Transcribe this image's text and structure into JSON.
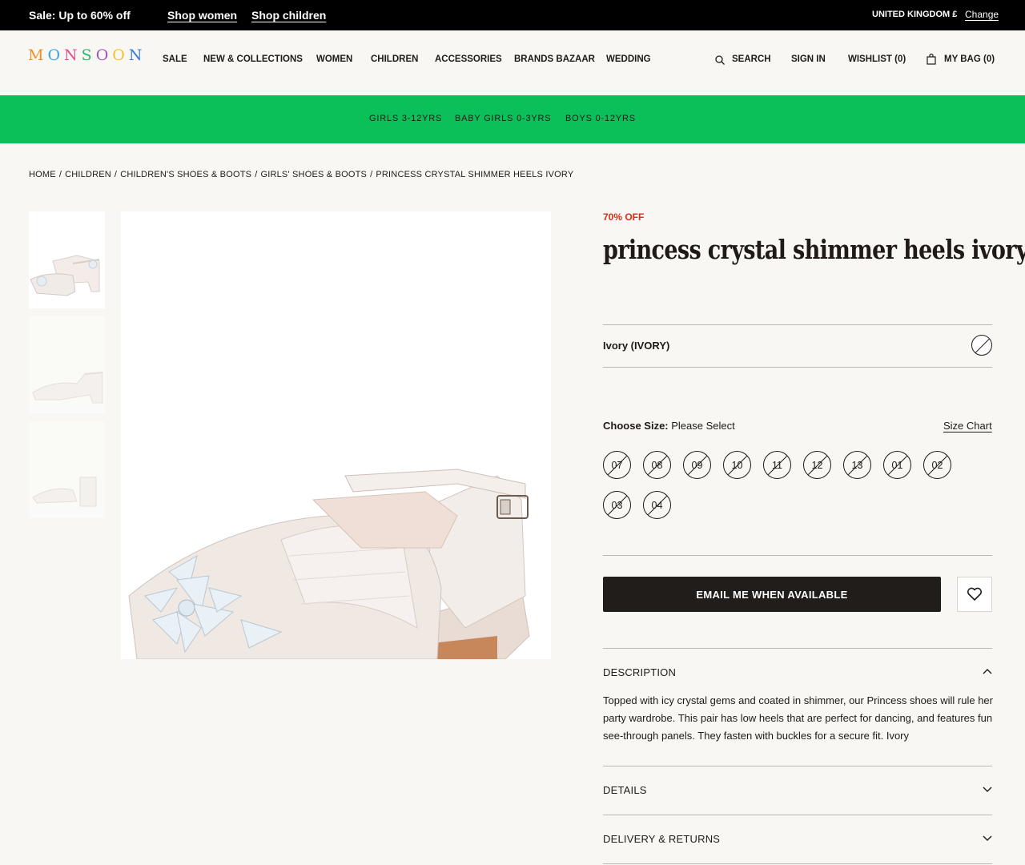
{
  "promo": {
    "sale_text": "Sale: Up to 60% off",
    "links": [
      "Shop women",
      "Shop children"
    ],
    "country": "UNITED KINGDOM £",
    "change": "Change"
  },
  "header": {
    "logo": "MONSOON",
    "logo_colors": [
      "#f28c28",
      "#3aa6dd",
      "#e54e8a",
      "#2bb673",
      "#9b59b6",
      "#f2c12e",
      "#3a7bd5"
    ],
    "nav": [
      "SALE",
      "NEW & COLLECTIONS",
      "WOMEN",
      "CHILDREN",
      "ACCESSORIES",
      "BRANDS BAZAAR",
      "WEDDING"
    ],
    "search": "SEARCH",
    "sign_in": "SIGN IN",
    "wishlist": "WISHLIST (0)",
    "bag": "MY BAG (0)"
  },
  "category_bar": {
    "color": "#0bbf59",
    "items": [
      "GIRLS 3-12YRS",
      "BABY GIRLS 0-3YRS",
      "BOYS 0-12YRS"
    ]
  },
  "breadcrumb": [
    "HOME",
    "CHILDREN",
    "CHILDREN'S SHOES & BOOTS",
    "GIRLS' SHOES & BOOTS",
    "PRINCESS CRYSTAL SHIMMER HEELS IVORY"
  ],
  "product": {
    "discount": "70% OFF",
    "title": "princess crystal shimmer heels ivory",
    "colour": "Ivory (IVORY)",
    "size_prompt": "Choose Size:",
    "size_value": "Please Select",
    "size_chart": "Size Chart",
    "sizes": [
      "07",
      "08",
      "09",
      "10",
      "11",
      "12",
      "13",
      "01",
      "02",
      "03",
      "04"
    ],
    "email_button": "EMAIL ME WHEN AVAILABLE"
  },
  "accordion": {
    "description_title": "DESCRIPTION",
    "description_text": "Topped with icy crystal gems and coated in shimmer, our Princess shoes will rule her party wardrobe. This pair has low heels that are perfect for dancing, and features fun see-through panels. They fasten with buckles for a secure fit. Ivory",
    "details_title": "DETAILS",
    "delivery_title": "DELIVERY & RETURNS"
  }
}
